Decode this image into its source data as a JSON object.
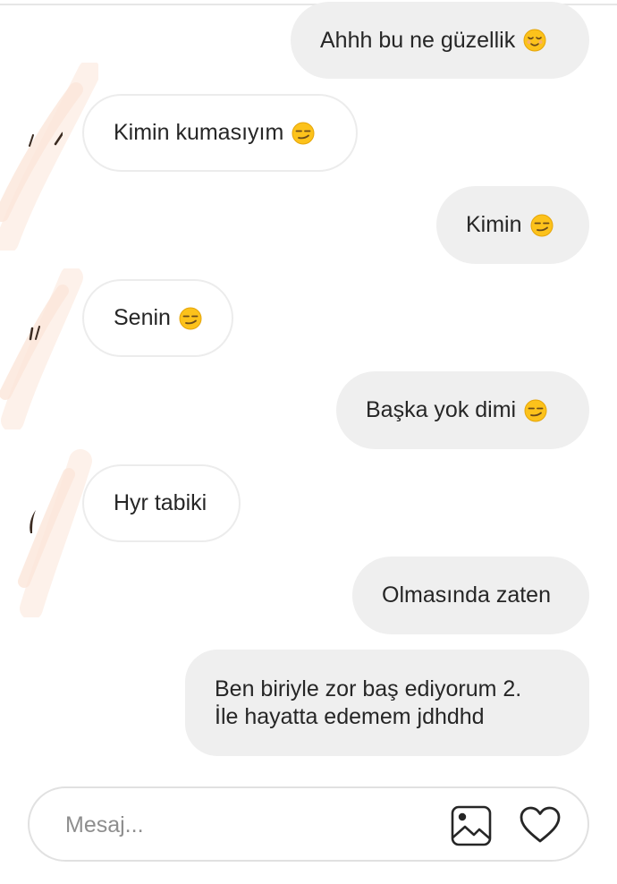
{
  "messages": [
    {
      "side": "out",
      "text": "Ahhh bu ne güzellik",
      "emoji": "relieved-face"
    },
    {
      "side": "in",
      "text": "Kimin kumasıyım",
      "emoji": "smirking-face"
    },
    {
      "side": "out",
      "text": "Kimin",
      "emoji": "smirking-face"
    },
    {
      "side": "in",
      "text": "Senin",
      "emoji": "smirking-face"
    },
    {
      "side": "out",
      "text": "Başka yok dimi",
      "emoji": "smirking-face"
    },
    {
      "side": "in",
      "text": "Hyr tabiki"
    },
    {
      "side": "out",
      "text": "Olmasında zaten"
    },
    {
      "side": "out",
      "lines": [
        "Ben biriyle zor baş ediyorum 2.",
        "İle hayatta edemem jdhdhd"
      ]
    }
  ],
  "composer": {
    "placeholder": "Mesaj...",
    "value": "",
    "gallery_icon": "image-gallery-icon",
    "like_icon": "heart-icon"
  },
  "colors": {
    "outgoing_bubble": "#efefef",
    "incoming_border": "#ececec",
    "text": "#262626",
    "placeholder": "#8e8e8e",
    "emoji_yellow": "#fcc21b"
  }
}
